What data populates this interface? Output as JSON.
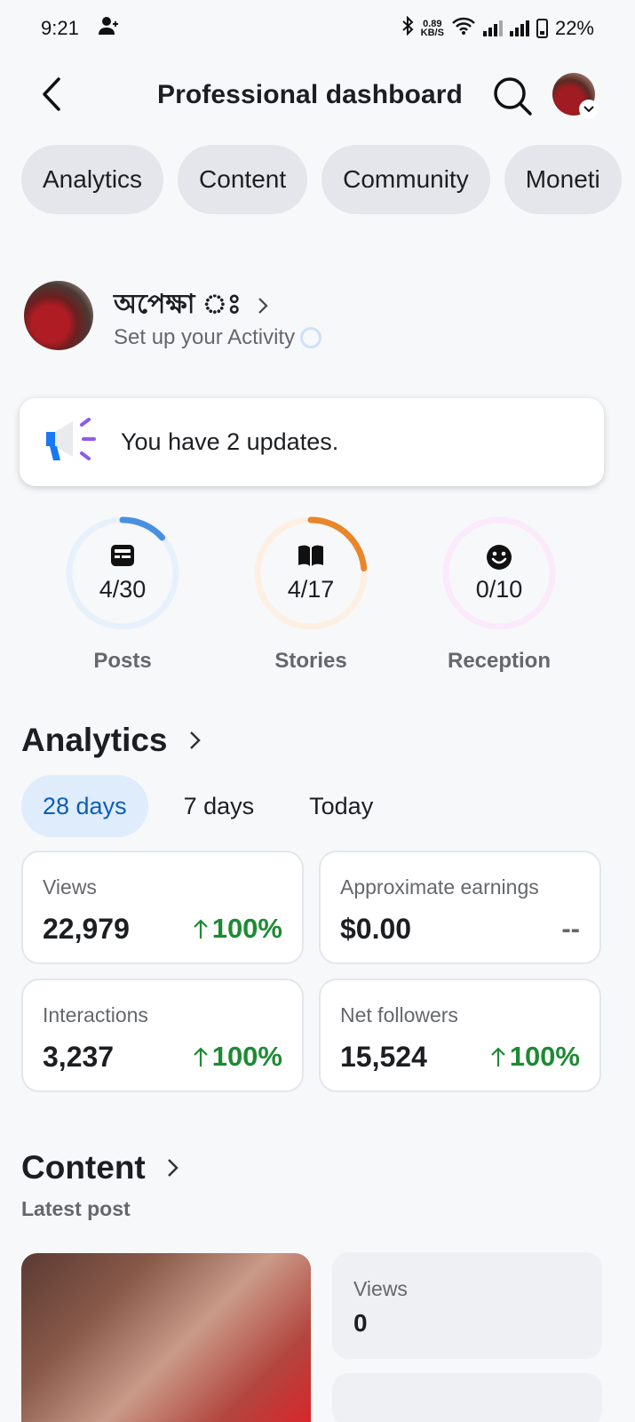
{
  "status_bar": {
    "time": "9:21",
    "net_speed_value": "0.89",
    "net_speed_unit": "KB/S",
    "battery": "22%"
  },
  "header": {
    "title": "Professional dashboard"
  },
  "tabs": [
    "Analytics",
    "Content",
    "Community",
    "Moneti"
  ],
  "profile": {
    "name": "অপেক্ষা ঃ",
    "subtitle": "Set up your Activity"
  },
  "updates": {
    "text": "You have 2 updates."
  },
  "goals": [
    {
      "count": "4/30",
      "label": "Posts",
      "progress": 0.1333,
      "color": "#4a90e2",
      "track": "#e7f1fc",
      "icon": "post-icon"
    },
    {
      "count": "4/17",
      "label": "Stories",
      "progress": 0.2353,
      "color": "#e8862a",
      "track": "#fdf0e3",
      "icon": "book-icon"
    },
    {
      "count": "0/10",
      "label": "Reception",
      "progress": 0,
      "color": "#d65fd6",
      "track": "#fbeafb",
      "icon": "smile-icon"
    }
  ],
  "analytics": {
    "title": "Analytics",
    "ranges": [
      "28 days",
      "7 days",
      "Today"
    ],
    "active_range": "28 days",
    "stats": [
      {
        "label": "Views",
        "value": "22,979",
        "change": "100%"
      },
      {
        "label": "Approximate earnings",
        "value": "$0.00",
        "change": "--"
      },
      {
        "label": "Interactions",
        "value": "3,237",
        "change": "100%"
      },
      {
        "label": "Net followers",
        "value": "15,524",
        "change": "100%"
      }
    ],
    "positive_color": "#1e8a34"
  },
  "content": {
    "title": "Content",
    "subtitle": "Latest post",
    "views_label": "Views",
    "views_value": "0"
  }
}
